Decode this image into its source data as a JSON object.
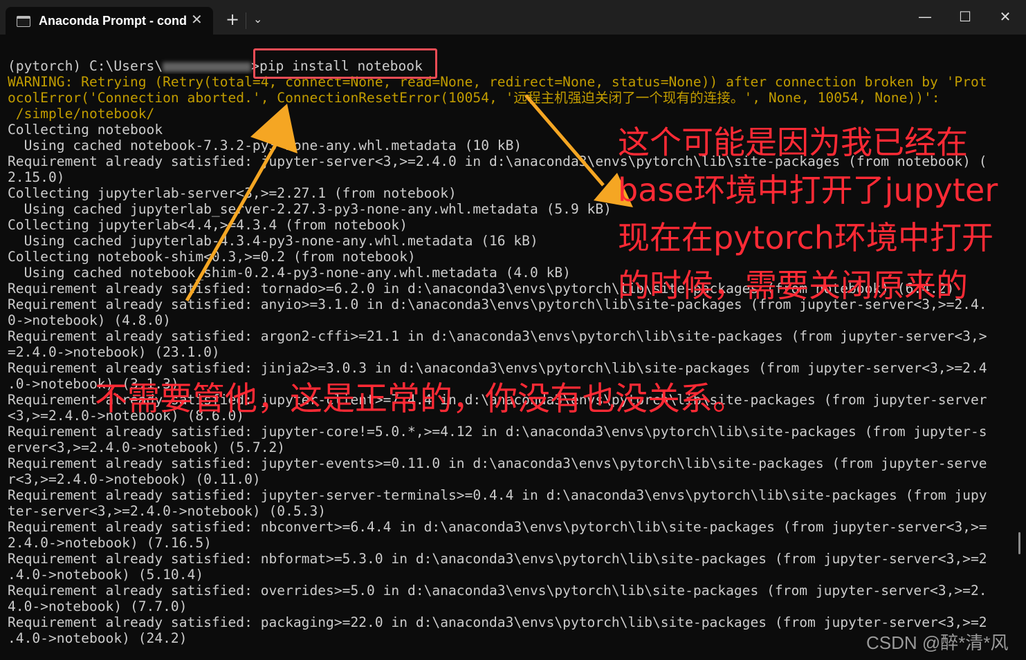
{
  "window": {
    "tab_title": "Anaconda Prompt - cond",
    "tab_close": "✕",
    "new_tab": "+",
    "dropdown": "⌄",
    "minimize": "—",
    "maximize": "☐",
    "close": "✕"
  },
  "terminal": {
    "prompt_prefix": "(pytorch) C:\\Users\\",
    "prompt_suffix": ">",
    "command": "pip install notebook",
    "lines": [
      {
        "text": "WARNING: Retrying (Retry(total=4, connect=None, read=None, redirect=None, status=None)) after connection broken by 'Prot",
        "type": "warning"
      },
      {
        "text": "ocolError('Connection aborted.', ConnectionResetError(10054, '远程主机强迫关闭了一个现有的连接。', None, 10054, None))':",
        "type": "warning"
      },
      {
        "text": " /simple/notebook/",
        "type": "warning"
      },
      {
        "text": "Collecting notebook",
        "type": "normal"
      },
      {
        "text": "  Using cached notebook-7.3.2-py3-none-any.whl.metadata (10 kB)",
        "type": "normal"
      },
      {
        "text": "Requirement already satisfied: jupyter-server<3,>=2.4.0 in d:\\anaconda3\\envs\\pytorch\\lib\\site-packages (from notebook) (",
        "type": "normal"
      },
      {
        "text": "2.15.0)",
        "type": "normal"
      },
      {
        "text": "Collecting jupyterlab-server<3,>=2.27.1 (from notebook)",
        "type": "normal"
      },
      {
        "text": "  Using cached jupyterlab_server-2.27.3-py3-none-any.whl.metadata (5.9 kB)",
        "type": "normal"
      },
      {
        "text": "Collecting jupyterlab<4.4,>=4.3.4 (from notebook)",
        "type": "normal"
      },
      {
        "text": "  Using cached jupyterlab-4.3.4-py3-none-any.whl.metadata (16 kB)",
        "type": "normal"
      },
      {
        "text": "Collecting notebook-shim<0.3,>=0.2 (from notebook)",
        "type": "normal"
      },
      {
        "text": "  Using cached notebook_shim-0.2.4-py3-none-any.whl.metadata (4.0 kB)",
        "type": "normal"
      },
      {
        "text": "Requirement already satisfied: tornado>=6.2.0 in d:\\anaconda3\\envs\\pytorch\\lib\\site-packages (from notebook) (6.4.2)",
        "type": "normal"
      },
      {
        "text": "Requirement already satisfied: anyio>=3.1.0 in d:\\anaconda3\\envs\\pytorch\\lib\\site-packages (from jupyter-server<3,>=2.4.",
        "type": "normal"
      },
      {
        "text": "0->notebook) (4.8.0)",
        "type": "normal"
      },
      {
        "text": "Requirement already satisfied: argon2-cffi>=21.1 in d:\\anaconda3\\envs\\pytorch\\lib\\site-packages (from jupyter-server<3,>",
        "type": "normal"
      },
      {
        "text": "=2.4.0->notebook) (23.1.0)",
        "type": "normal"
      },
      {
        "text": "Requirement already satisfied: jinja2>=3.0.3 in d:\\anaconda3\\envs\\pytorch\\lib\\site-packages (from jupyter-server<3,>=2.4",
        "type": "normal"
      },
      {
        "text": ".0->notebook) (3.1.3)",
        "type": "normal"
      },
      {
        "text": "Requirement already satisfied: jupyter-client>=7.4.4 in d:\\anaconda3\\envs\\pytorch\\lib\\site-packages (from jupyter-server",
        "type": "normal"
      },
      {
        "text": "<3,>=2.4.0->notebook) (8.6.0)",
        "type": "normal"
      },
      {
        "text": "Requirement already satisfied: jupyter-core!=5.0.*,>=4.12 in d:\\anaconda3\\envs\\pytorch\\lib\\site-packages (from jupyter-s",
        "type": "normal"
      },
      {
        "text": "erver<3,>=2.4.0->notebook) (5.7.2)",
        "type": "normal"
      },
      {
        "text": "Requirement already satisfied: jupyter-events>=0.11.0 in d:\\anaconda3\\envs\\pytorch\\lib\\site-packages (from jupyter-serve",
        "type": "normal"
      },
      {
        "text": "r<3,>=2.4.0->notebook) (0.11.0)",
        "type": "normal"
      },
      {
        "text": "Requirement already satisfied: jupyter-server-terminals>=0.4.4 in d:\\anaconda3\\envs\\pytorch\\lib\\site-packages (from jupy",
        "type": "normal"
      },
      {
        "text": "ter-server<3,>=2.4.0->notebook) (0.5.3)",
        "type": "normal"
      },
      {
        "text": "Requirement already satisfied: nbconvert>=6.4.4 in d:\\anaconda3\\envs\\pytorch\\lib\\site-packages (from jupyter-server<3,>=",
        "type": "normal"
      },
      {
        "text": "2.4.0->notebook) (7.16.5)",
        "type": "normal"
      },
      {
        "text": "Requirement already satisfied: nbformat>=5.3.0 in d:\\anaconda3\\envs\\pytorch\\lib\\site-packages (from jupyter-server<3,>=2",
        "type": "normal"
      },
      {
        "text": ".4.0->notebook) (5.10.4)",
        "type": "normal"
      },
      {
        "text": "Requirement already satisfied: overrides>=5.0 in d:\\anaconda3\\envs\\pytorch\\lib\\site-packages (from jupyter-server<3,>=2.",
        "type": "normal"
      },
      {
        "text": "4.0->notebook) (7.7.0)",
        "type": "normal"
      },
      {
        "text": "Requirement already satisfied: packaging>=22.0 in d:\\anaconda3\\envs\\pytorch\\lib\\site-packages (from jupyter-server<3,>=2",
        "type": "normal"
      },
      {
        "text": ".4.0->notebook) (24.2)",
        "type": "normal"
      }
    ]
  },
  "annotations": {
    "note_right_lines": [
      "这个可能是因为我已经在",
      "base环境中打开了jupyter",
      "现在在pytorch环境中打开",
      "的时候，需要关闭原来的"
    ],
    "note_bottom": "不需要管他，这是正常的，你没有也没关系。",
    "annotation_color": "#ff2a35",
    "arrow_color": "#f5a623"
  },
  "watermark": "CSDN @醉*清*风",
  "colors": {
    "terminal_bg": "#0c0c0c",
    "terminal_text": "#cccccc",
    "warning_text": "#c19c00",
    "titlebar_bg": "#202020",
    "highlight_box": "#ef4c55"
  }
}
